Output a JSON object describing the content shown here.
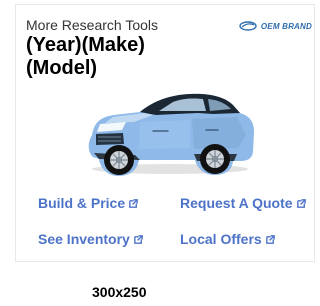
{
  "ad": {
    "section_title": "More Research Tools",
    "brand_label": "OEM BRAND",
    "vehicle_title": {
      "line1": "(Year)(Make)",
      "line2": "(Model)"
    },
    "image_alt": "blue SUV",
    "links": {
      "build_price": "Build & Price",
      "request_quote": "Request A Quote",
      "see_inventory": "See Inventory",
      "local_offers": "Local Offers"
    },
    "icons": {
      "brand": "oem-brand-logo-icon",
      "external": "external-link-icon"
    },
    "colors": {
      "link": "#4d73c8",
      "brand": "#2f6fb0",
      "vehicle": "#8fb9e8"
    }
  },
  "caption": "300x250"
}
